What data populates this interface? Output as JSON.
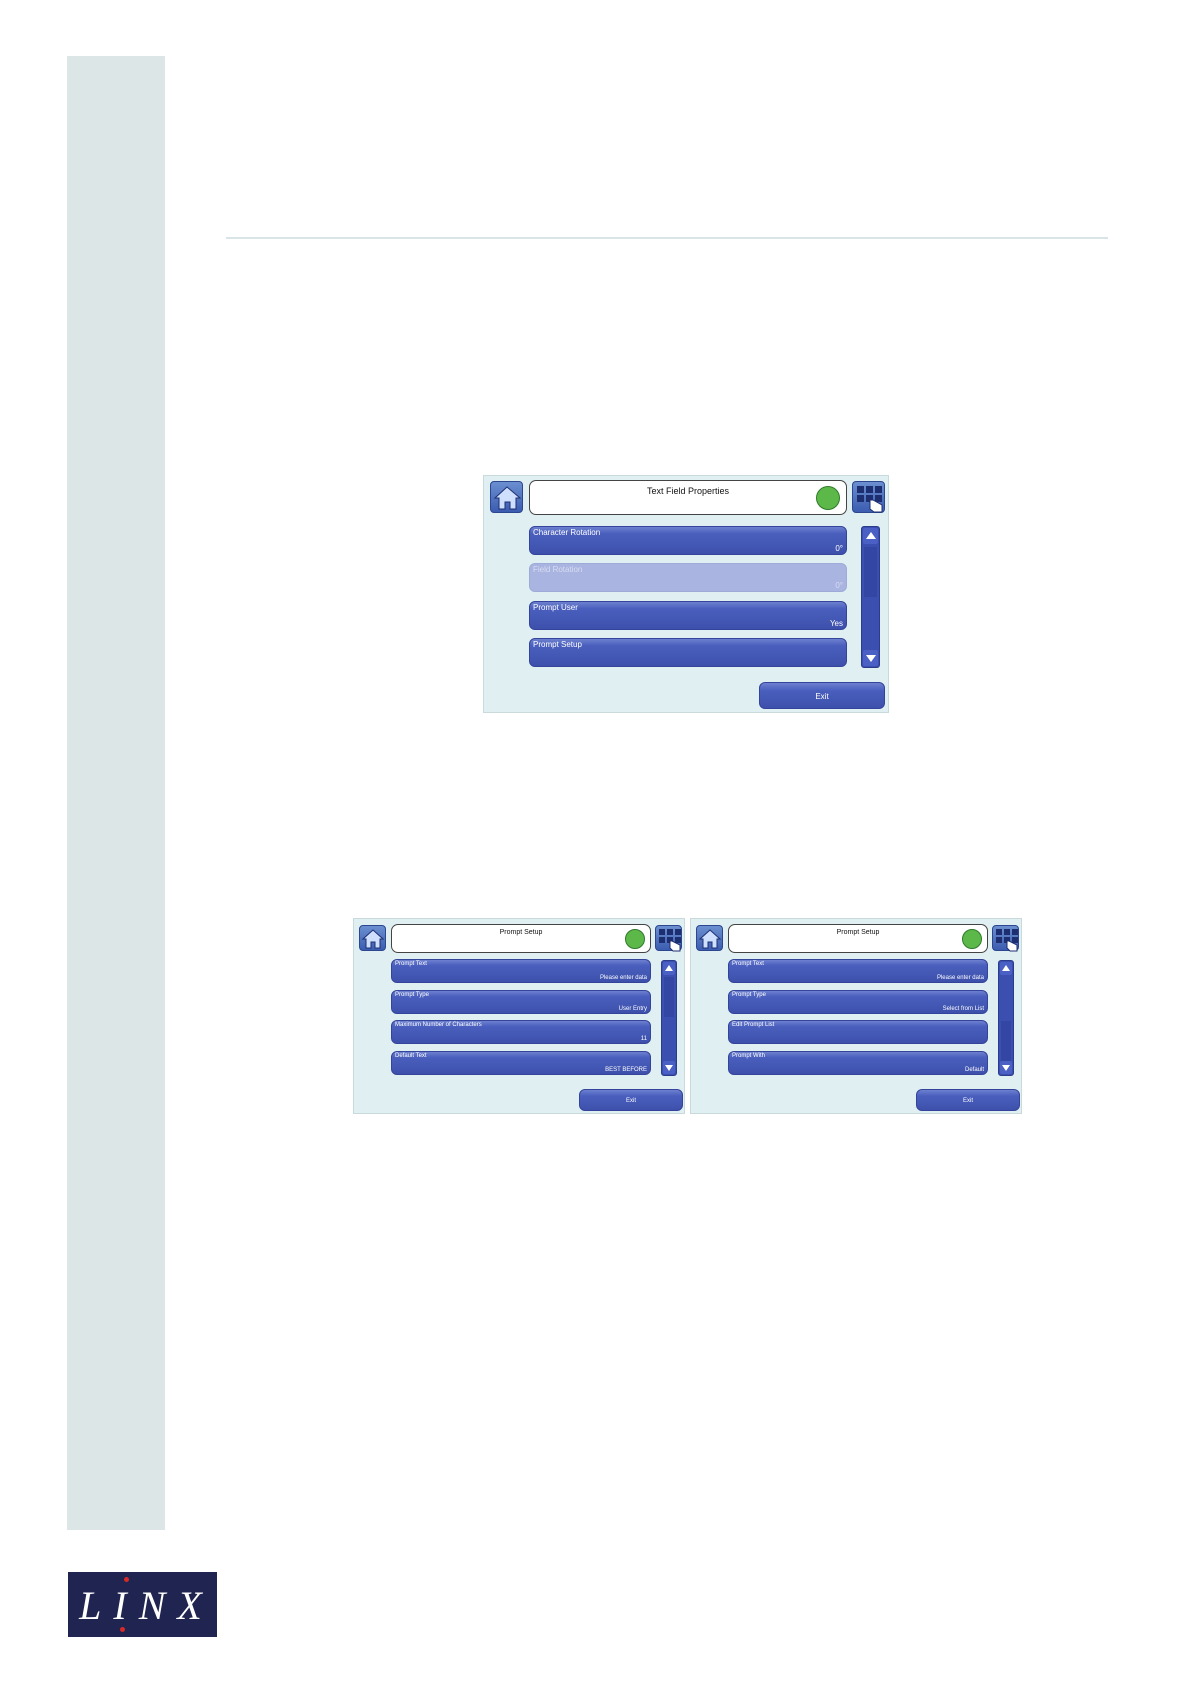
{
  "brand": {
    "logo_text": "LINX"
  },
  "screens": [
    {
      "title": "Text Field Properties",
      "rows": [
        {
          "label": "Character Rotation",
          "value": "0°",
          "disabled": false
        },
        {
          "label": "Field Rotation",
          "value": "0°",
          "disabled": true
        },
        {
          "label": "Prompt User",
          "value": "Yes",
          "disabled": false
        },
        {
          "label": "Prompt Setup",
          "value": "",
          "disabled": false
        }
      ],
      "exit_label": "Exit"
    },
    {
      "title": "Prompt Setup",
      "rows": [
        {
          "label": "Prompt Text",
          "value": "Please enter data"
        },
        {
          "label": "Prompt Type",
          "value": "User Entry"
        },
        {
          "label": "Maximum Number of Characters",
          "value": "11"
        },
        {
          "label": "Default Text",
          "value": "BEST BEFORE"
        }
      ],
      "exit_label": "Exit"
    },
    {
      "title": "Prompt Setup",
      "rows": [
        {
          "label": "Prompt Text",
          "value": "Please enter data"
        },
        {
          "label": "Prompt Type",
          "value": "Select from List"
        },
        {
          "label": "Edit Prompt List",
          "value": ""
        },
        {
          "label": "Prompt With",
          "value": "Default"
        }
      ],
      "exit_label": "Exit"
    }
  ],
  "colors": {
    "status_ok": "#5db84a",
    "button_blue": "#3d50ac",
    "band": "#dde6e6",
    "logo_bg": "#1f2550"
  },
  "icons": [
    "home-icon",
    "keypad-hand-icon",
    "status-led",
    "scroll-up-icon",
    "scroll-down-icon"
  ]
}
